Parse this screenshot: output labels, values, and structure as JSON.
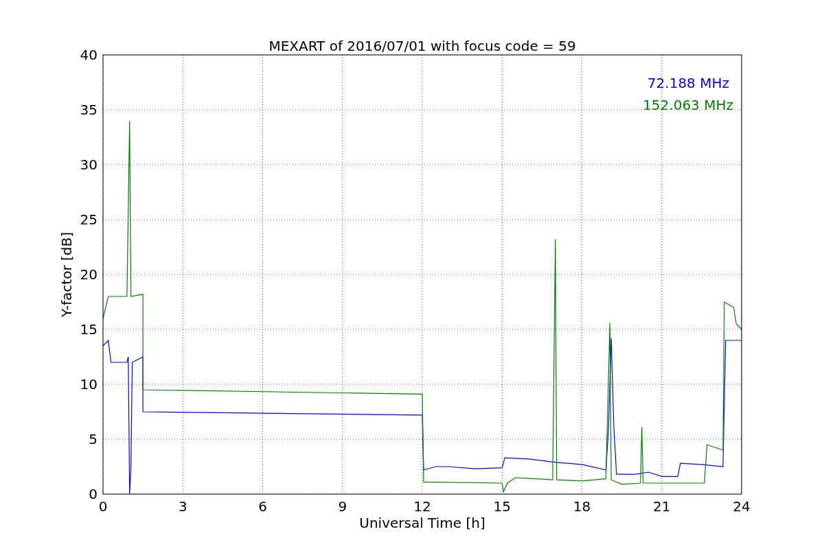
{
  "chart_data": {
    "type": "line",
    "grid": true,
    "title": "MEXART of 2016/07/01 with focus code = 59",
    "xlabel": "Universal Time [h]",
    "ylabel": "Y-factor [dB]",
    "xlim": [
      0,
      24
    ],
    "ylim": [
      0,
      40
    ],
    "xticks": [
      0,
      3,
      6,
      9,
      12,
      15,
      18,
      21,
      24
    ],
    "yticks": [
      0,
      5,
      10,
      15,
      20,
      25,
      30,
      35,
      40
    ],
    "series": [
      {
        "name": "72.188 MHz",
        "color": "#0000ff",
        "x": [
          0,
          0.2,
          0.3,
          0.9,
          0.95,
          1.0,
          1.05,
          1.1,
          1.5,
          1.5,
          12,
          12.05,
          12.5,
          13,
          14,
          15,
          15.1,
          16,
          17,
          18,
          18.9,
          19,
          19.1,
          19.2,
          19.3,
          20,
          20.5,
          21,
          21.6,
          21.7,
          22.5,
          23.3,
          23.4,
          24
        ],
        "values": [
          13.5,
          14,
          12,
          12,
          12.5,
          0,
          2.5,
          12,
          12.5,
          7.5,
          7.2,
          2.2,
          2.5,
          2.5,
          2.3,
          2.4,
          3.3,
          3.2,
          2.9,
          2.7,
          2.2,
          6,
          14.2,
          6,
          1.8,
          1.8,
          2,
          1.6,
          1.6,
          2.8,
          2.7,
          2.5,
          14,
          14
        ]
      },
      {
        "name": "152.063 MHz",
        "color": "#008000",
        "x": [
          0,
          0.2,
          0.9,
          1.0,
          1.05,
          1.5,
          1.5,
          12,
          12.05,
          15,
          15.05,
          15.2,
          15.5,
          16.9,
          17,
          17.05,
          18,
          18.9,
          19.05,
          19.1,
          19.5,
          20.2,
          20.25,
          20.3,
          22.6,
          22.7,
          23.3,
          23.35,
          23.7,
          23.8,
          24
        ],
        "values": [
          16,
          18,
          18,
          34,
          18,
          18.2,
          9.5,
          9.1,
          1.1,
          1.0,
          0.2,
          1,
          1.5,
          1.3,
          23.2,
          1.3,
          1.2,
          1.4,
          15.6,
          1.3,
          0.9,
          1,
          6.1,
          1,
          1,
          4.5,
          4,
          17.5,
          17,
          15.5,
          15
        ]
      }
    ]
  }
}
